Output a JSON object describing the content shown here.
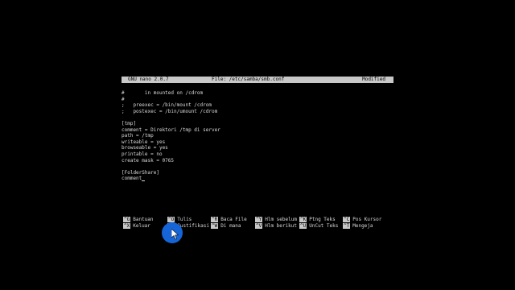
{
  "titlebar": {
    "app": "GNU nano 2.0.7",
    "file": "File: /etc/samba/smb.conf",
    "status": "Modified"
  },
  "editor": {
    "lines": [
      "#       in mounted on /cdrom",
      "#",
      ";   preexec = /bin/mount /cdrom",
      ";   postexec = /bin/umount /cdrom",
      "",
      "[tmp]",
      "comment = Direktori /tmp di server",
      "path = /tmp",
      "writeable = yes",
      "browseable = yes",
      "printable = no",
      "create mask = 0765",
      "",
      "[FolderShare]",
      "comment"
    ]
  },
  "shortcuts": {
    "row1": [
      {
        "key": "^G",
        "label": "Bantuan"
      },
      {
        "key": "^O",
        "label": "Tulis"
      },
      {
        "key": "^R",
        "label": "Baca File"
      },
      {
        "key": "^Y",
        "label": "Hlm sebelum"
      },
      {
        "key": "^K",
        "label": "Ptng Teks"
      },
      {
        "key": "^C",
        "label": "Pos Kursor"
      }
    ],
    "row2": [
      {
        "key": "^X",
        "label": "Keluar"
      },
      {
        "key": "^J",
        "label": "Justifikasi"
      },
      {
        "key": "^W",
        "label": "Di mana"
      },
      {
        "key": "^V",
        "label": "Hlm berikut"
      },
      {
        "key": "^U",
        "label": "UnCut Teks"
      },
      {
        "key": "^T",
        "label": "Mengeja"
      }
    ]
  },
  "colors": {
    "background": "#000000",
    "bar": "#c8c8c8",
    "text": "#d8d8d8",
    "pointer_highlight": "#1565d8"
  }
}
